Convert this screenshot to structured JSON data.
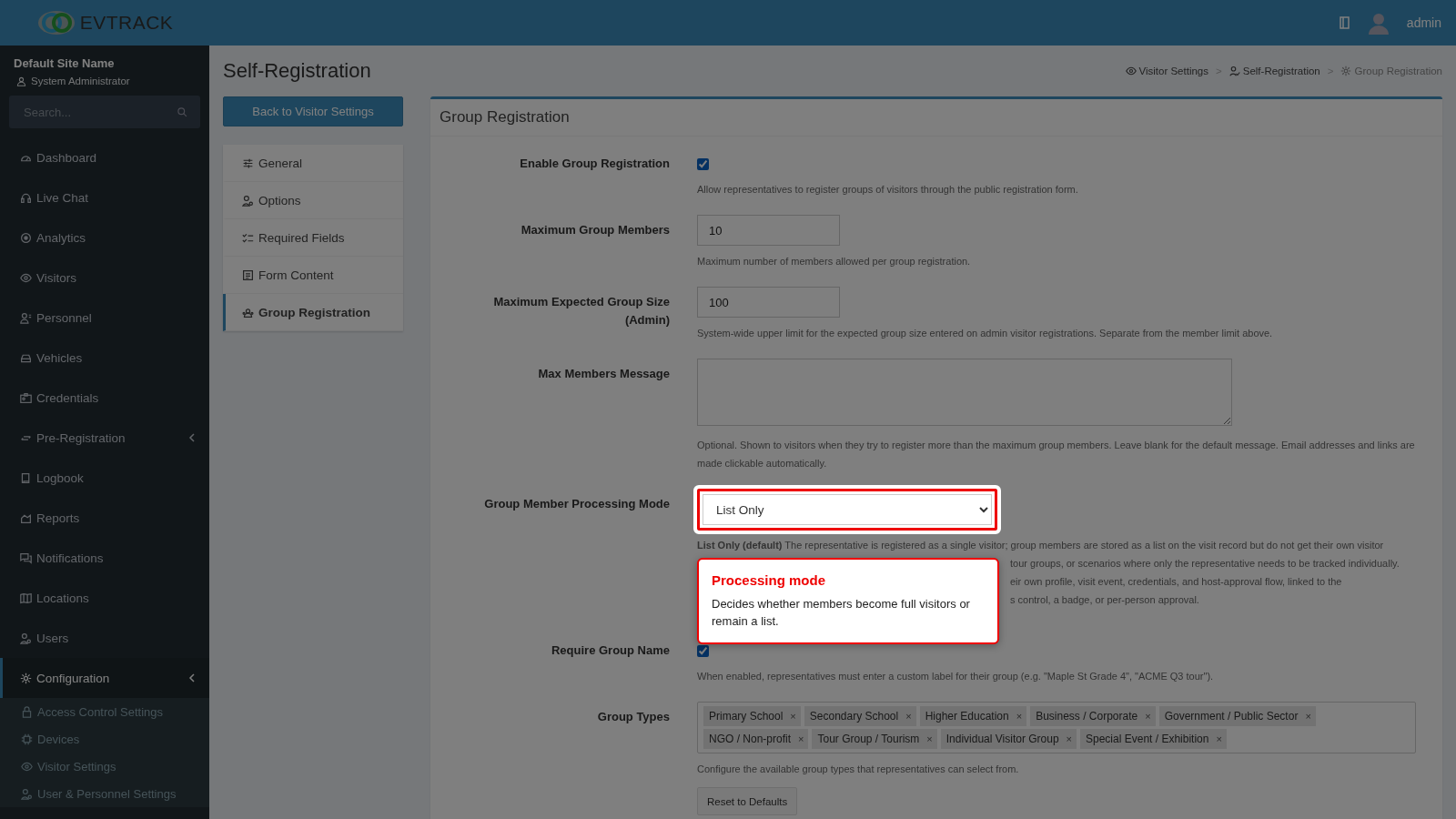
{
  "brand": "**EV**TRACK",
  "topbar": {
    "user": "admin"
  },
  "sidebar": {
    "site": "Default Site Name",
    "role": "System Administrator",
    "search": {
      "placeholder": "Search..."
    },
    "items": [
      {
        "label": "Dashboard",
        "selected": false,
        "has_submenu": false
      },
      {
        "label": "Live Chat",
        "selected": false,
        "has_submenu": false
      },
      {
        "label": "Analytics",
        "selected": false,
        "has_submenu": false
      },
      {
        "label": "Visitors",
        "selected": false,
        "has_submenu": false
      },
      {
        "label": "Personnel",
        "selected": false,
        "has_submenu": false
      },
      {
        "label": "Vehicles",
        "selected": false,
        "has_submenu": false
      },
      {
        "label": "Credentials",
        "selected": false,
        "has_submenu": false
      },
      {
        "label": "Pre-Registration",
        "selected": false,
        "has_submenu": true
      },
      {
        "label": "Logbook",
        "selected": false,
        "has_submenu": false
      },
      {
        "label": "Reports",
        "selected": false,
        "has_submenu": false
      },
      {
        "label": "Notifications",
        "selected": false,
        "has_submenu": false
      },
      {
        "label": "Locations",
        "selected": false,
        "has_submenu": false
      },
      {
        "label": "Users",
        "selected": false,
        "has_submenu": false
      },
      {
        "label": "Configuration",
        "selected": true,
        "has_submenu": true,
        "children": [
          {
            "label": "Access Control Settings",
            "selected": false
          },
          {
            "label": "Devices",
            "selected": false
          },
          {
            "label": "Visitor Settings",
            "selected": false
          },
          {
            "label": "User & Personnel Settings",
            "selected": false
          }
        ]
      }
    ]
  },
  "page": {
    "title": "Self-Registration",
    "back_button": "Back to Visitor Settings",
    "breadcrumb": [
      {
        "label": "Visitor Settings",
        "current": false
      },
      {
        "label": "Self-Registration",
        "current": false
      },
      {
        "label": "Group Registration",
        "current": true
      }
    ],
    "breadcrumb_separator": ">"
  },
  "subnav": [
    {
      "label": "General",
      "selected": false
    },
    {
      "label": "Options",
      "selected": false
    },
    {
      "label": "Required Fields",
      "selected": false
    },
    {
      "label": "Form Content",
      "selected": false
    },
    {
      "label": "Group Registration",
      "selected": true
    }
  ],
  "card": {
    "title": "Group Registration",
    "fields": [
      {
        "kind": "checkbox",
        "label": "Enable Group Registration",
        "checked": true,
        "help": [
          "Allow representatives to register groups of visitors through the public registration form."
        ]
      },
      {
        "kind": "number",
        "label": "Maximum Group Members",
        "value": "10",
        "help": [
          "Maximum number of members allowed per group registration."
        ]
      },
      {
        "kind": "number",
        "label": "Maximum Expected Group Size (Admin)",
        "value": "100",
        "help": [
          "System-wide upper limit for the expected group size entered on admin visitor registrations. Separate from the member limit above."
        ]
      },
      {
        "kind": "textarea",
        "label": "Max Members Message",
        "help": [
          "Optional. Shown to visitors when they try to register more than the maximum group members. Leave blank for the default message. Email addresses and links are made clickable automatically."
        ]
      },
      {
        "kind": "select",
        "label": "Group Member Processing Mode",
        "value": "List Only",
        "highlighted": true,
        "tour": {
          "title": "Processing mode",
          "text": "Decides whether members become full visitors or remain a list."
        },
        "help_lines": [
          {
            "text": "**List Only (default)** The representative is registered as a single visitor; group members are stored as a list on the visit record but do not get their own visitor",
            "covered_left": false
          },
          {
            "text": "tour groups, or scenarios where only the representative needs to be tracked individually.",
            "covered_left": true
          },
          {
            "text": "eir own profile, visit event, credentials, and host-approval flow, linked to the",
            "covered_left": true
          },
          {
            "text": "s control, a badge, or per-person approval.",
            "covered_left": true
          }
        ]
      },
      {
        "kind": "checkbox",
        "label": "Require Group Name",
        "checked": true,
        "help": [
          "When enabled, representatives must enter a custom label for their group (e.g. \"Maple St Grade 4\", \"ACME Q3 tour\")."
        ]
      },
      {
        "kind": "tags",
        "label": "Group Types",
        "remove_mark": "×",
        "tags": [
          "Primary School",
          "Secondary School",
          "Higher Education",
          "Business / Corporate",
          "Government / Public Sector",
          "NGO / Non-profit",
          "Tour Group / Tourism",
          "Individual Visitor Group",
          "Special Event / Exhibition"
        ],
        "help": [
          "Configure the available group types that representatives can select from."
        ],
        "button": "Reset to Defaults"
      }
    ]
  }
}
